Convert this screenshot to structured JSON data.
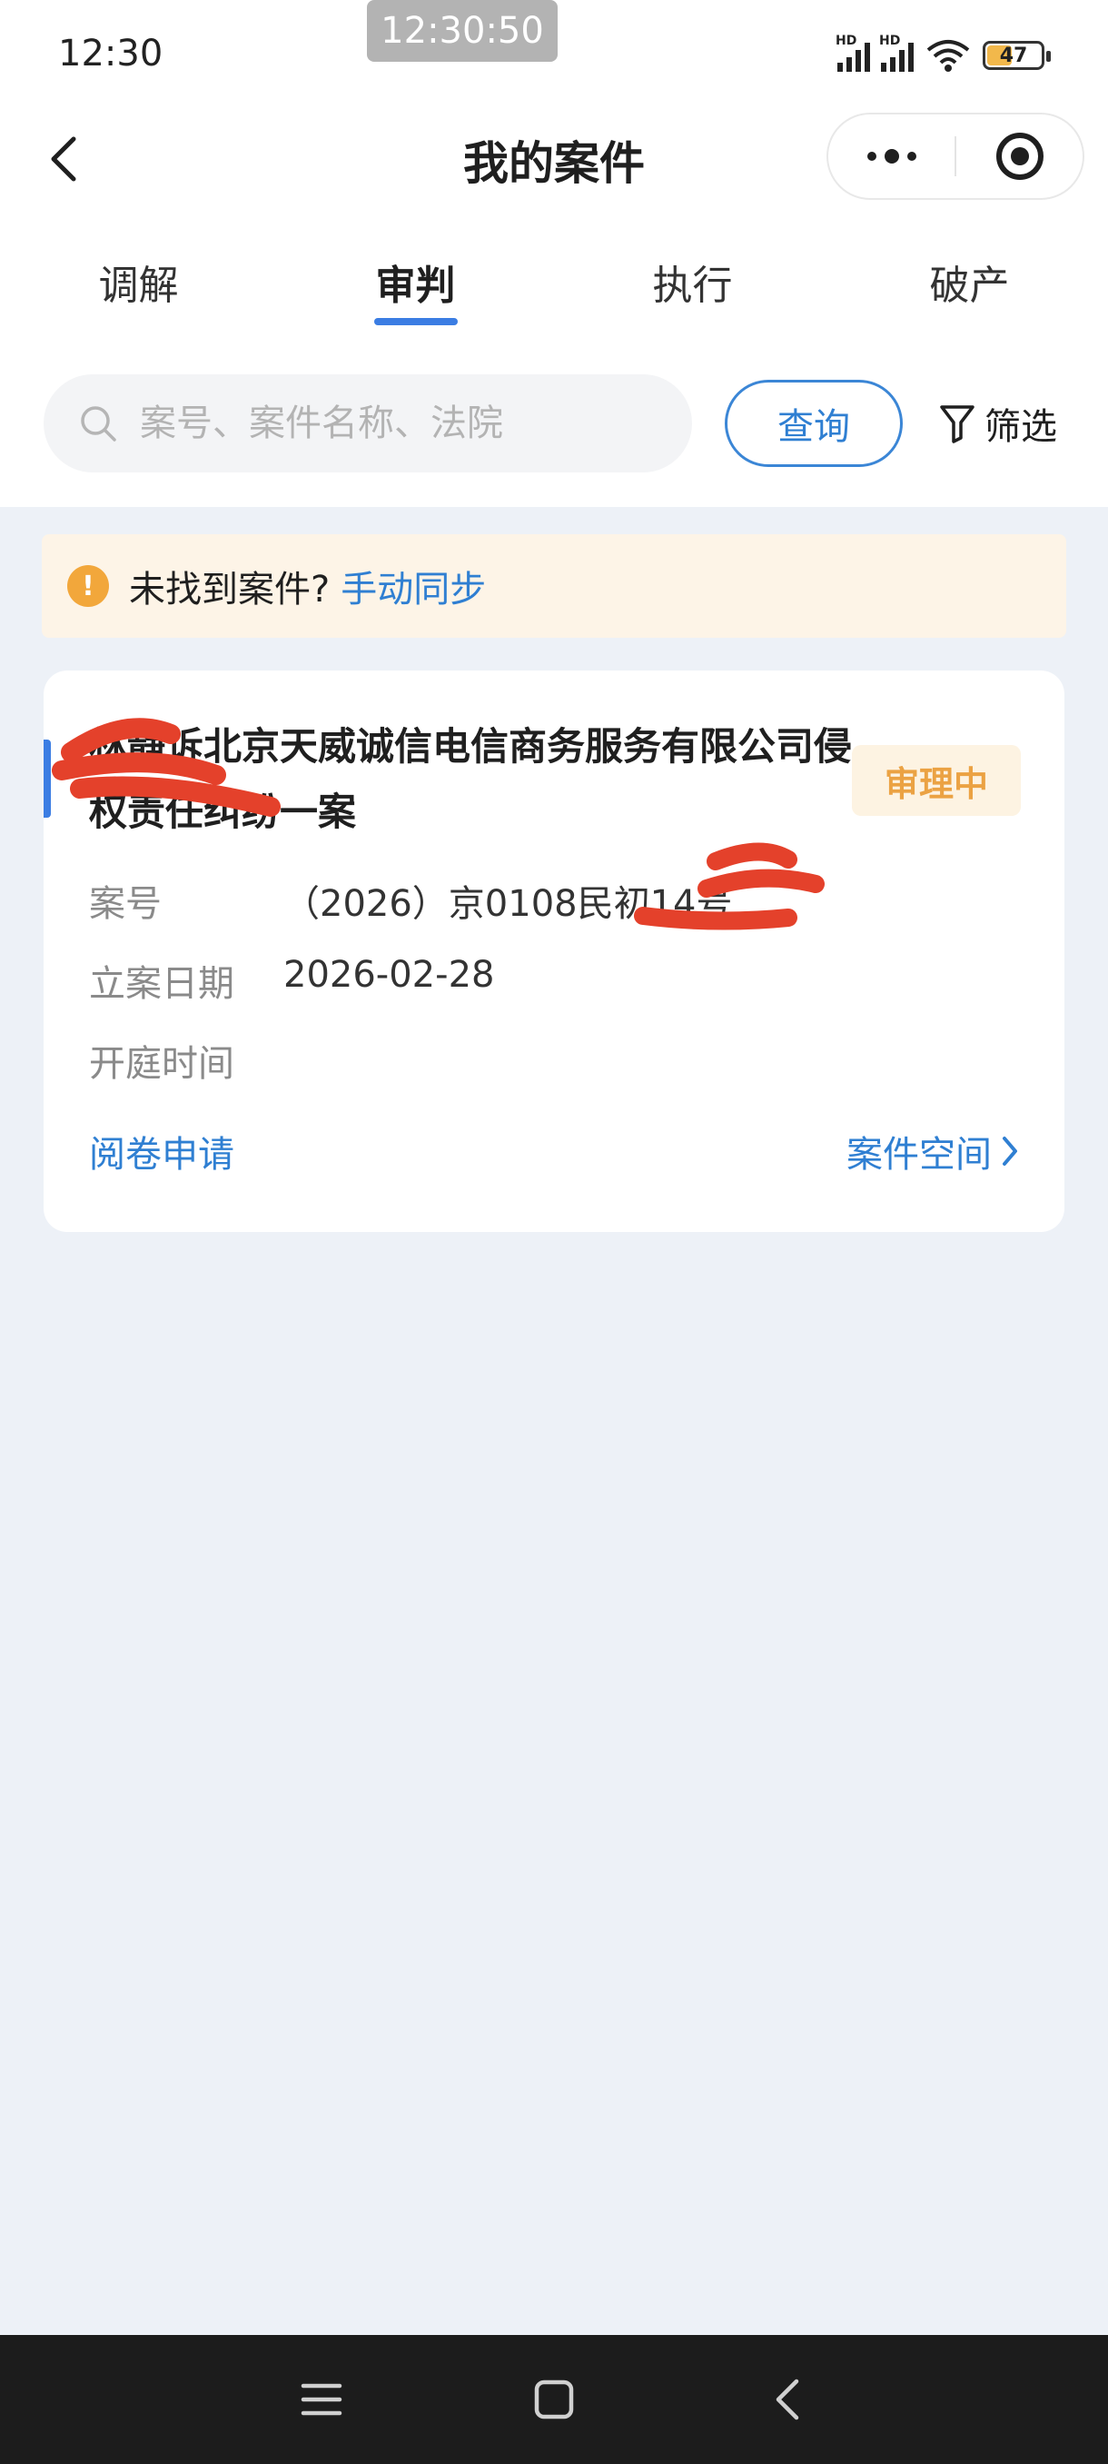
{
  "status_bar": {
    "time": "12:30",
    "overlay_time": "12:30:50",
    "hd_label": "HD",
    "battery_level": "47",
    "battery_percent": 47
  },
  "header": {
    "title": "我的案件"
  },
  "tabs": [
    {
      "label": "调解",
      "active": false
    },
    {
      "label": "审判",
      "active": true
    },
    {
      "label": "执行",
      "active": false
    },
    {
      "label": "破产",
      "active": false
    }
  ],
  "search": {
    "placeholder": "案号、案件名称、法院",
    "value": "",
    "button_label": "查询",
    "filter_label": "筛选"
  },
  "notice": {
    "text": "未找到案件?",
    "link": "手动同步"
  },
  "case": {
    "title": "林静诉北京天威诚信电信商务服务有限公司侵权责任纠纷一案",
    "status": "审理中",
    "fields": [
      {
        "label": "案号",
        "value": "（2026）京0108民初14号"
      },
      {
        "label": "立案日期",
        "value": "2026-02-28"
      },
      {
        "label": "开庭时间",
        "value": ""
      }
    ],
    "action_left": "阅卷申请",
    "action_right": "案件空间"
  },
  "colors": {
    "accent_blue": "#3b7de3",
    "link_blue": "#2f7fd2",
    "status_orange": "#eba243",
    "notice_bg": "#fdf4e7",
    "page_bg": "#edf1f7",
    "redaction_red": "#e4412b"
  },
  "icons": [
    "back-arrow-icon",
    "more-dots-icon",
    "target-icon",
    "search-icon",
    "filter-icon",
    "warning-icon",
    "chevron-right-icon",
    "menu-icon",
    "home-square-icon",
    "back-triangle-icon"
  ]
}
